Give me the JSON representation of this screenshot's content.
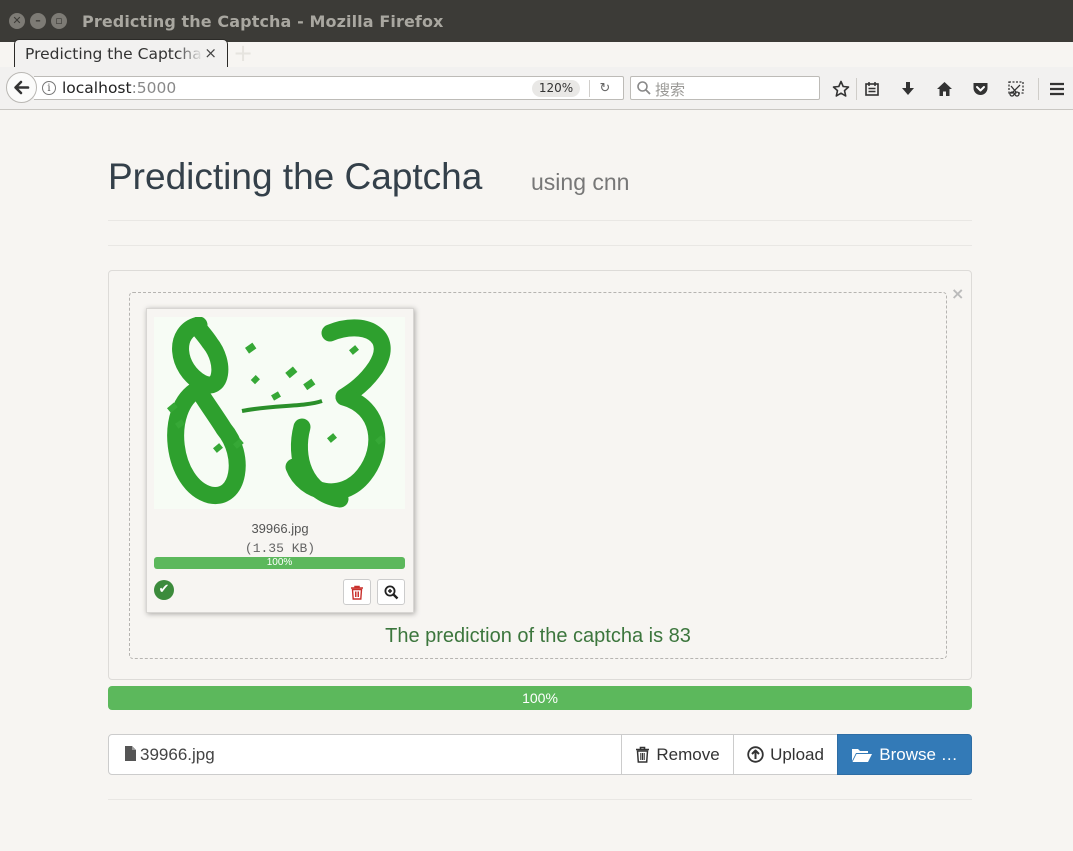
{
  "window": {
    "title": "Predicting the Captcha - Mozilla Firefox",
    "controls": [
      "close",
      "minimize",
      "maximize"
    ]
  },
  "tab": {
    "label": "Predicting the Captcha",
    "close": "×"
  },
  "new_tab_label": "+",
  "navbar": {
    "url_host": "localhost",
    "url_port": ":5000",
    "zoom": "120%",
    "search_placeholder": "搜索",
    "toolbar_icons": [
      "star-icon",
      "reading-list-icon",
      "download-icon",
      "home-icon",
      "pocket-icon",
      "screenshot-icon",
      "menu-icon"
    ]
  },
  "page": {
    "title": "Predicting the Captcha",
    "subtitle": "using cnn"
  },
  "panel": {
    "close": "×",
    "thumbnail": {
      "image_alt": "83",
      "file_name": "39966.jpg",
      "file_size": "(1.35 KB)",
      "progress_label": "100%",
      "progress_value": 1.0
    },
    "prediction": "The prediction of the captcha is 83"
  },
  "overall_progress": {
    "label": "100%",
    "value": 1.0
  },
  "file_input": {
    "value": "39966.jpg"
  },
  "buttons": {
    "remove": "Remove",
    "upload": "Upload",
    "browse": "Browse …"
  },
  "colors": {
    "success": "#5cb85c",
    "prediction_text": "#3c763d",
    "primary": "#337ab7",
    "captcha_green": "#2ea02e"
  }
}
